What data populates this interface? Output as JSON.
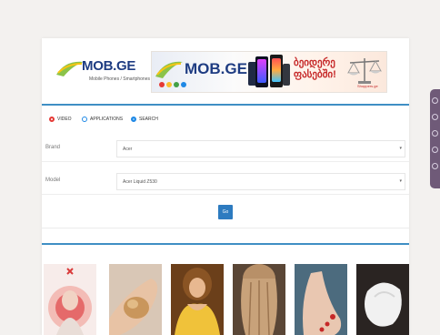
{
  "header": {
    "logo": {
      "brand": "MOB.GE",
      "tagline": "Mobile Phones / Smartphones"
    },
    "banner": {
      "brand": "MOB.GE",
      "georgian_line1": "ბეიდერე",
      "georgian_line2": "ფასებში!",
      "scale_label": "Shoppers.ge",
      "dot_colors": [
        "#e53935",
        "#fbc02d",
        "#43a047",
        "#1e88e5"
      ]
    }
  },
  "tabs": [
    {
      "label": "Video",
      "icon": "video-radio-icon",
      "color": "#e53935",
      "selected": true
    },
    {
      "label": "Applications",
      "icon": "applications-radio-icon",
      "color": "#1e88e5",
      "selected": false
    },
    {
      "label": "Search",
      "icon": "search-radio-icon",
      "color": "#1e88e5",
      "selected": true
    }
  ],
  "form": {
    "brand_label": "Brand",
    "brand_value": "Acer",
    "model_label": "Model",
    "model_value": "Acer Liquid Z530",
    "go_label": "Go"
  },
  "thumbnails": [
    {
      "name": "thumb-woman-red",
      "bg": "#f0d5d2",
      "accent": "#d93a3a"
    },
    {
      "name": "thumb-hand-object",
      "bg": "#dcc2a4",
      "accent": "#c58f62"
    },
    {
      "name": "thumb-woman-yellow",
      "bg": "#7d4e22",
      "accent": "#f0c23a"
    },
    {
      "name": "thumb-hair",
      "bg": "#9a7c5e",
      "accent": "#c8a27a"
    },
    {
      "name": "thumb-foot",
      "bg": "#4c6b7e",
      "accent": "#e9c7b1"
    },
    {
      "name": "thumb-white-object",
      "bg": "#2a2422",
      "accent": "#f1f1f1"
    }
  ],
  "colors": {
    "accent_line": "#3f8fc4",
    "button": "#2d7bc0",
    "side_tab": "#6f5a78",
    "logo_text": "#1e3c82"
  }
}
